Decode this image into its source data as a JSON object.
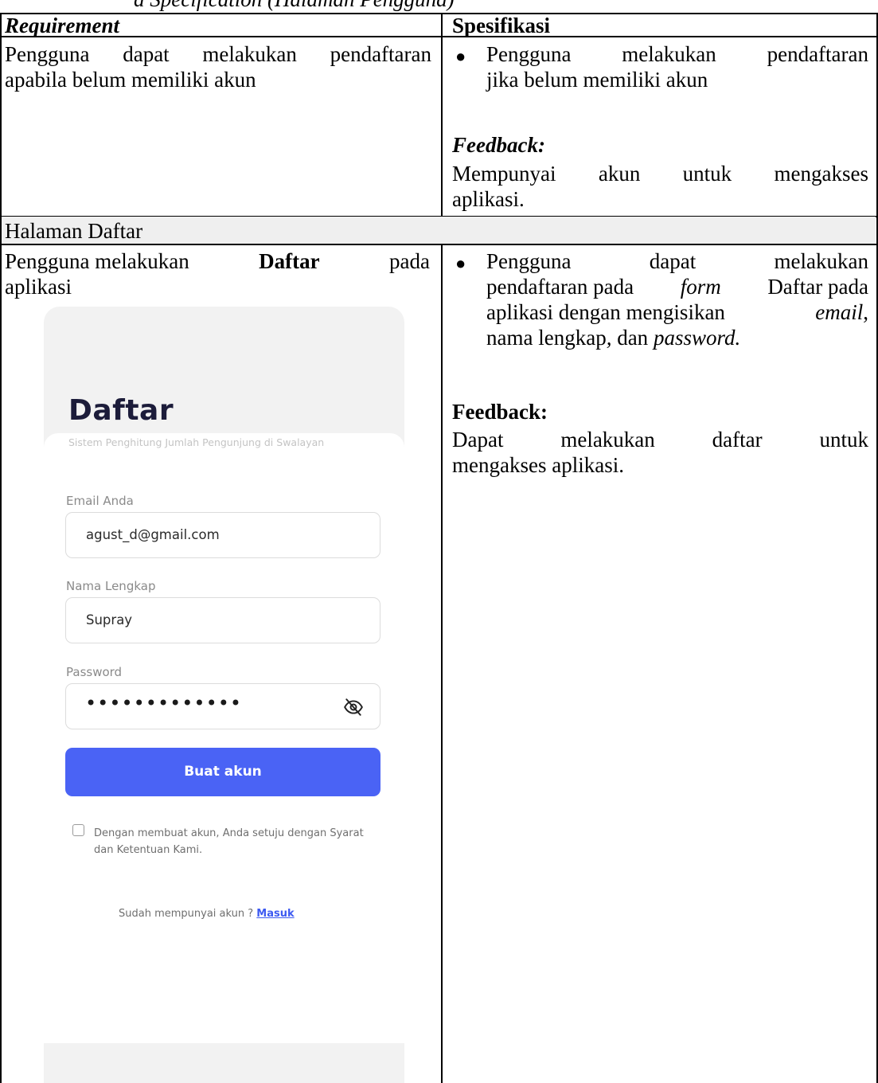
{
  "caption_fragment": "a Specification (Halaman Pengguna)",
  "table": {
    "header": {
      "requirement": "Requirement",
      "spesifikasi": "Spesifikasi"
    },
    "row1": {
      "requirement_line1": "Pengguna dapat melakukan pendaftaran",
      "requirement_line2": "apabila belum memiliki akun",
      "spec_bullet_line1": "Pengguna melakukan pendaftaran",
      "spec_bullet_line2": "jika belum memiliki akun",
      "feedback_label": "Feedback:",
      "feedback_line1": "Mempunyai akun untuk mengakses",
      "feedback_line2": "aplikasi."
    },
    "section_title": "Halaman Daftar",
    "row2": {
      "req_prefix": "Pengguna melakukan",
      "req_bold": "Daftar",
      "req_suffix": "pada",
      "req_line2": "aplikasi",
      "spec_l1": "Pengguna dapat melakukan",
      "spec_l2_a": "pendaftaran pada",
      "spec_l2_form": "form",
      "spec_l2_b": "Daftar pada",
      "spec_l3_a": "aplikasi dengan mengisikan",
      "spec_l3_email": "email",
      "spec_l3_comma": ",",
      "spec_l4_a": "nama lengkap",
      "spec_l4_comma": ",",
      "spec_l4_b": "dan",
      "spec_l4_password": "password.",
      "feedback_label": "Feedback:",
      "feedback_line1": "Dapat melakukan daftar untuk",
      "feedback_line2": "mengakses aplikasi."
    }
  },
  "app": {
    "title": "Daftar",
    "subtitle": "Sistem Penghitung Jumlah Pengunjung di Swalayan",
    "email_label": "Email Anda",
    "email_value": "agust_d@gmail.com",
    "name_label": "Nama Lengkap",
    "name_value": "Supray",
    "password_label": "Password",
    "password_mask": "•••••••••••••",
    "create_button": "Buat akun",
    "terms_text": "Dengan membuat akun, Anda setuju dengan Syarat dan Ketentuan Kami.",
    "login_prompt": "Sudah mempunyai akun ?",
    "login_link": "Masuk",
    "accent_color": "#4a63f5",
    "eye_icon": "eye-off-icon"
  }
}
